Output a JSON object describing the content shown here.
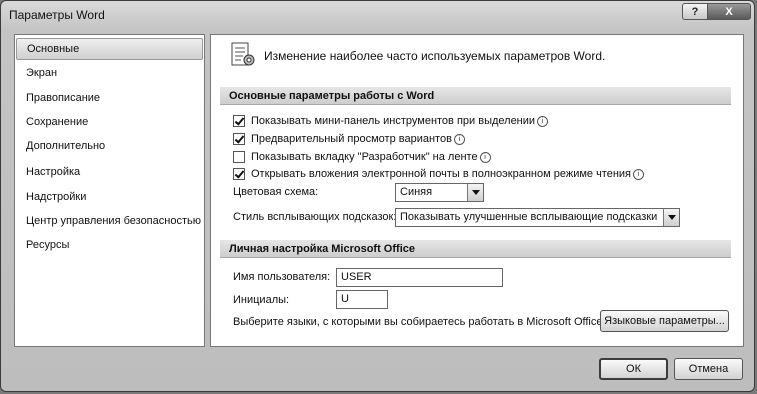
{
  "window": {
    "title": "Параметры Word",
    "help_label": "?",
    "close_label": "X"
  },
  "sidebar": {
    "items": [
      {
        "label": "Основные",
        "selected": true
      },
      {
        "label": "Экран"
      },
      {
        "label": "Правописание"
      },
      {
        "label": "Сохранение"
      },
      {
        "label": "Дополнительно"
      },
      {
        "label": "Настройка"
      },
      {
        "label": "Надстройки"
      },
      {
        "label": "Центр управления безопасностью"
      },
      {
        "label": "Ресурсы"
      }
    ]
  },
  "main": {
    "header": "Изменение наиболее часто используемых параметров Word.",
    "section1": {
      "title": "Основные параметры работы с Word",
      "options": [
        {
          "label": "Показывать мини-панель инструментов при выделении",
          "checked": true
        },
        {
          "label": "Предварительный просмотр вариантов",
          "checked": true
        },
        {
          "label": "Показывать вкладку \"Разработчик\" на ленте",
          "checked": false
        },
        {
          "label": "Открывать вложения электронной почты в полноэкранном режиме чтения",
          "checked": true
        }
      ],
      "info_glyph": "i",
      "color_scheme_label": "Цветовая схема:",
      "color_scheme_value": "Синяя",
      "tooltip_style_label": "Стиль всплывающих подсказок:",
      "tooltip_style_value": "Показывать улучшенные всплывающие подсказки"
    },
    "section2": {
      "title": "Личная настройка Microsoft Office",
      "username_label": "Имя пользователя:",
      "username_value": "USER",
      "initials_label": "Инициалы:",
      "initials_value": "U",
      "languages_label": "Выберите языки, с которыми вы собираетесь работать в Microsoft Office:",
      "languages_button": "Языковые параметры..."
    }
  },
  "footer": {
    "ok_label": "ОК",
    "cancel_label": "Отмена"
  }
}
